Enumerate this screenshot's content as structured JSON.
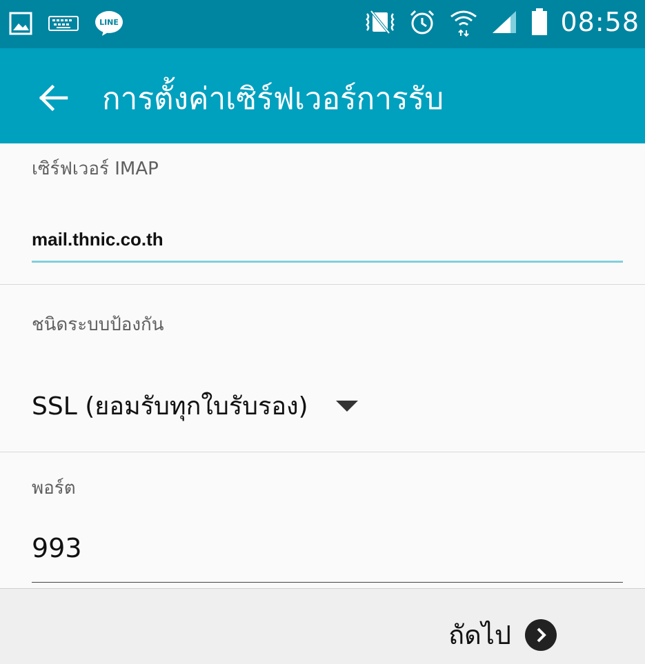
{
  "status_bar": {
    "time": "08:58",
    "left_icons": [
      "image-icon",
      "keyboard-icon",
      "line-app-icon"
    ],
    "right_icons": [
      "vibrate-icon",
      "alarm-icon",
      "wifi-icon",
      "signal-icon",
      "battery-icon"
    ]
  },
  "app_bar": {
    "title": "การตั้งค่าเซิร์ฟเวอร์การรับ",
    "back_icon": "arrow-left-icon"
  },
  "form": {
    "imap_server": {
      "label": "เซิร์ฟเวอร์ IMAP",
      "value": "mail.thnic.co.th"
    },
    "security_type": {
      "label": "ชนิดระบบป้องกัน",
      "selected": "SSL (ยอมรับทุกใบรับรอง)",
      "dropdown_icon": "triangle-down-icon"
    },
    "port": {
      "label": "พอร์ต",
      "value": "993"
    }
  },
  "footer": {
    "next_label": "ถัดไป",
    "next_icon": "chevron-right-circle-icon"
  },
  "colors": {
    "status_bar": "#0085a1",
    "app_bar": "#00a0bf",
    "focus_underline": "#7fd0df"
  }
}
